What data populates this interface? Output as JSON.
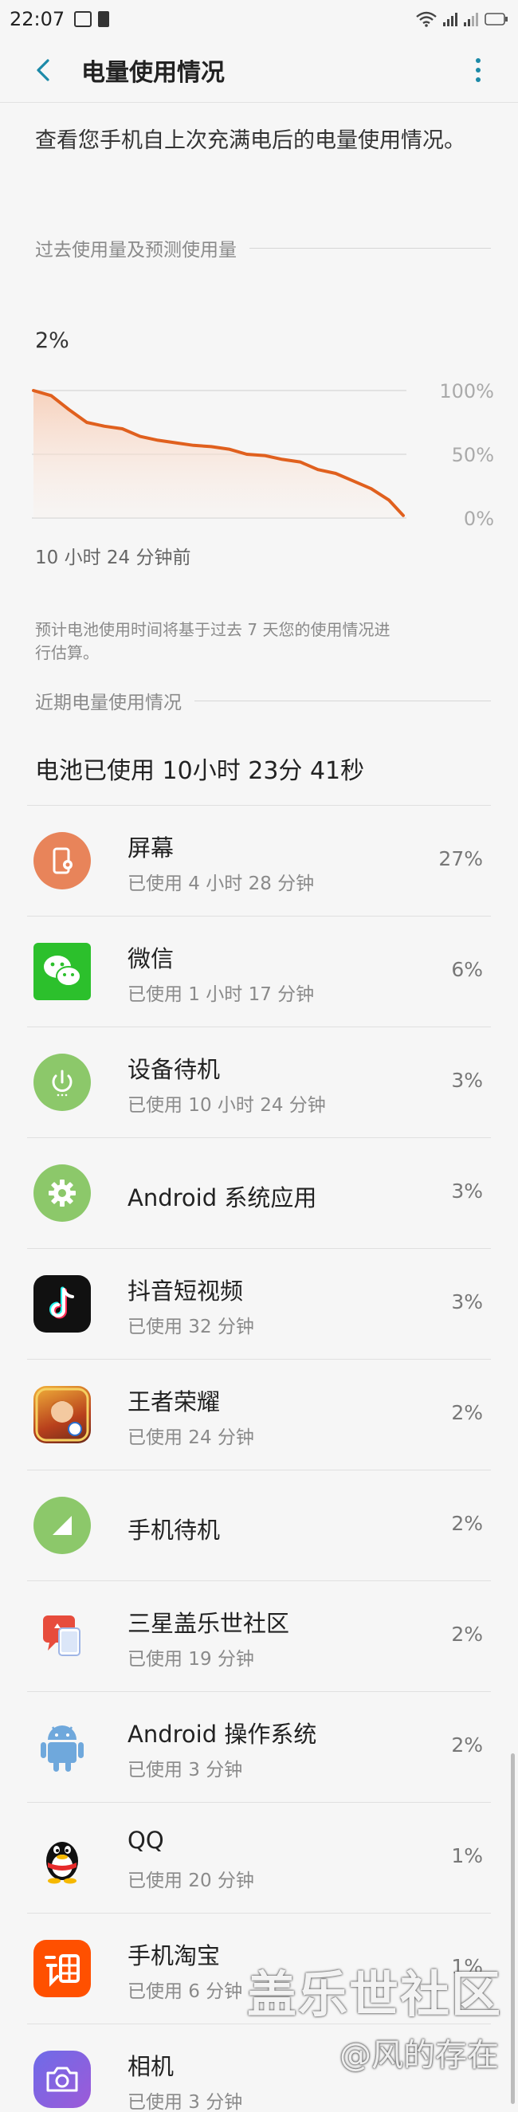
{
  "status_bar": {
    "time": "22:07"
  },
  "app_bar": {
    "title": "电量使用情况"
  },
  "intro": "查看您手机自上次充满电后的电量使用情况。",
  "history_section": {
    "title": "过去使用量及预测使用量",
    "current_level": "2%",
    "x_label": "10 小时 24 分钟前",
    "y_ticks": [
      "100%",
      "50%",
      "0%"
    ]
  },
  "chart_data": {
    "type": "area",
    "x_unit": "hours since full charge",
    "x": [
      0,
      0.5,
      1,
      1.5,
      2,
      2.5,
      3,
      3.5,
      4,
      4.5,
      5,
      5.5,
      6,
      6.5,
      7,
      7.5,
      8,
      8.5,
      9,
      9.5,
      10,
      10.4
    ],
    "y": [
      100,
      96,
      85,
      75,
      72,
      70,
      64,
      61,
      59,
      57,
      56,
      54,
      50,
      49,
      46,
      44,
      38,
      35,
      29,
      23,
      14,
      2
    ],
    "ylim": [
      0,
      100
    ],
    "color": "#e0601e"
  },
  "footnote": "预计电池使用时间将基于过去 7 天您的使用情况进行估算。",
  "recent_section": {
    "title": "近期电量使用情况"
  },
  "battery_used": "电池已使用 10小时 23分 41秒",
  "apps": [
    {
      "name": "屏幕",
      "usage": "已使用 4 小时 28 分钟",
      "pct": "27%",
      "icon": "screen-icon"
    },
    {
      "name": "微信",
      "usage": "已使用 1 小时 17 分钟",
      "pct": "6%",
      "icon": "wechat-icon"
    },
    {
      "name": "设备待机",
      "usage": "已使用 10 小时 24 分钟",
      "pct": "3%",
      "icon": "power-icon"
    },
    {
      "name": "Android 系统应用",
      "usage": "",
      "pct": "3%",
      "icon": "gear-icon"
    },
    {
      "name": "抖音短视频",
      "usage": "已使用 32 分钟",
      "pct": "3%",
      "icon": "douyin-icon"
    },
    {
      "name": "王者荣耀",
      "usage": "已使用 24 分钟",
      "pct": "2%",
      "icon": "game-icon"
    },
    {
      "name": "手机待机",
      "usage": "",
      "pct": "2%",
      "icon": "signal-icon"
    },
    {
      "name": "三星盖乐世社区",
      "usage": "已使用 19 分钟",
      "pct": "2%",
      "icon": "community-icon"
    },
    {
      "name": "Android 操作系统",
      "usage": "已使用 3 分钟",
      "pct": "2%",
      "icon": "android-icon"
    },
    {
      "name": "QQ",
      "usage": "已使用 20 分钟",
      "pct": "1%",
      "icon": "qq-icon"
    },
    {
      "name": "手机淘宝",
      "usage": "已使用 6 分钟",
      "pct": "1%",
      "icon": "taobao-icon"
    },
    {
      "name": "相机",
      "usage": "已使用 3 分钟",
      "pct": "",
      "icon": "camera-icon"
    }
  ],
  "watermark": {
    "line1": "盖乐世社区",
    "line2": "@风的存在"
  }
}
